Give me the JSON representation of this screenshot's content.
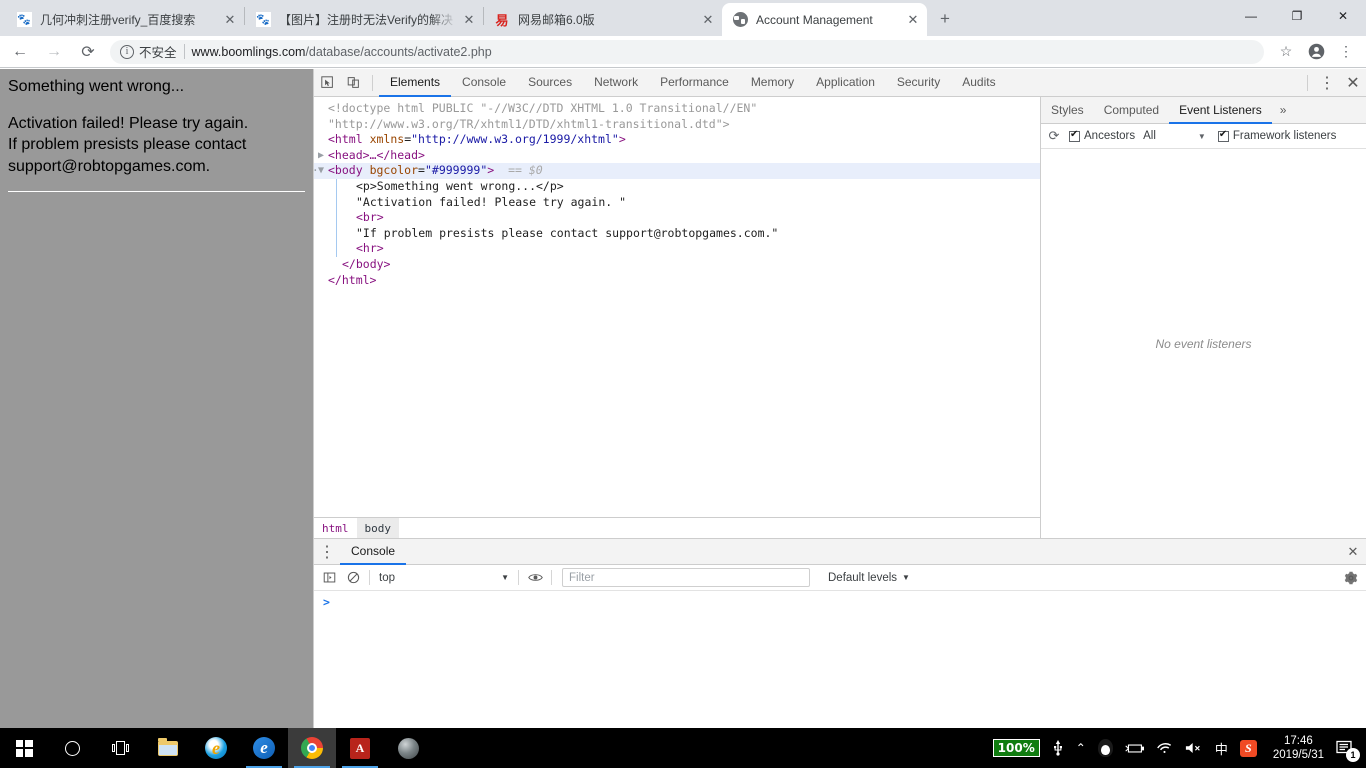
{
  "browser": {
    "tabs": [
      {
        "title": "几何冲刺注册verify_百度搜索",
        "favicon": "baidu-icon",
        "active": false
      },
      {
        "title": "【图片】注册时无法Verify的解决",
        "favicon": "baidu-icon",
        "active": false
      },
      {
        "title": "网易邮箱6.0版",
        "favicon": "netease-icon",
        "active": false
      },
      {
        "title": "Account Management",
        "favicon": "globe-icon",
        "active": true
      }
    ],
    "new_tab_label": "+",
    "window_controls": {
      "minimize": "—",
      "maximize": "❐",
      "close": "✕"
    },
    "toolbar": {
      "back": "←",
      "forward": "→",
      "reload": "⟳",
      "security_icon": "info-icon",
      "security_label": "不安全",
      "url_domain": "www.boomlings.com",
      "url_path": "/database/accounts/activate2.php",
      "bookmark": "☆",
      "profile": "account-icon",
      "menu": "⋮"
    }
  },
  "page": {
    "heading": "Something went wrong...",
    "line1": "Activation failed! Please try again.",
    "line2": "If problem presists please contact",
    "line3": "support@robtopgames.com.",
    "bgcolor": "#999999"
  },
  "devtools": {
    "inspect_icon": "inspect-cursor-icon",
    "device_icon": "device-toolbar-icon",
    "tabs": [
      {
        "label": "Elements",
        "active": true
      },
      {
        "label": "Console",
        "active": false
      },
      {
        "label": "Sources",
        "active": false
      },
      {
        "label": "Network",
        "active": false
      },
      {
        "label": "Performance",
        "active": false
      },
      {
        "label": "Memory",
        "active": false
      },
      {
        "label": "Application",
        "active": false
      },
      {
        "label": "Security",
        "active": false
      },
      {
        "label": "Audits",
        "active": false
      }
    ],
    "more_menu": "⋮",
    "close": "✕",
    "dom": {
      "line_doctype_1": "<!doctype html PUBLIC \"-//W3C//DTD XHTML 1.0 Transitional//EN\"",
      "line_doctype_2": "\"http://www.w3.org/TR/xhtml1/DTD/xhtml1-transitional.dtd\">",
      "html_tag_open": "<html",
      "html_attr_name": "xmlns",
      "html_attr_value": "\"http://www.w3.org/1999/xhtml\"",
      "html_tag_close": ">",
      "head_collapsed": "<head>…</head>",
      "body_tag_open": "<body",
      "body_attr_name": "bgcolor",
      "body_attr_value": "\"#999999\"",
      "body_tag_close": ">",
      "body_selected_marker": "== $0",
      "p_line": "<p>Something went wrong...</p>",
      "text_1": "\"Activation failed! Please try again. \"",
      "br_line": "<br>",
      "text_2": "\"If problem presists please contact support@robtopgames.com.\"",
      "hr_line": "<hr>",
      "body_end": "</body>",
      "html_end": "</html>"
    },
    "breadcrumb": [
      {
        "label": "html",
        "current": false
      },
      {
        "label": "body",
        "current": true
      }
    ],
    "sidebar": {
      "tabs": [
        {
          "label": "Styles",
          "active": false
        },
        {
          "label": "Computed",
          "active": false
        },
        {
          "label": "Event Listeners",
          "active": true
        }
      ],
      "more": "»",
      "refresh_icon": "refresh-icon",
      "ancestors_label": "Ancestors",
      "ancestors_checked": true,
      "filter_value": "All",
      "filter_caret": "▼",
      "framework_label": "Framework listeners",
      "framework_checked": true,
      "empty_message": "No event listeners"
    },
    "drawer": {
      "menu_icon": "⋮",
      "tab_label": "Console",
      "close": "✕",
      "toolbar": {
        "sidebar_icon": "console-sidebar-icon",
        "clear_icon": "clear-console-icon",
        "context_value": "top",
        "context_caret": "▼",
        "eye_icon": "live-expression-icon",
        "filter_placeholder": "Filter",
        "levels_label": "Default levels",
        "levels_caret": "▼",
        "settings_icon": "gear-icon"
      },
      "prompt": ">"
    }
  },
  "taskbar": {
    "items": [
      {
        "name": "start-button",
        "icon": "windows-logo-icon"
      },
      {
        "name": "search-button",
        "icon": "search-circle-icon"
      },
      {
        "name": "task-view-button",
        "icon": "task-view-icon"
      },
      {
        "name": "file-explorer-button",
        "icon": "folder-icon"
      },
      {
        "name": "internet-explorer-button",
        "icon": "internet-explorer-icon"
      },
      {
        "name": "edge-button",
        "icon": "edge-icon"
      },
      {
        "name": "chrome-button",
        "icon": "chrome-icon"
      },
      {
        "name": "acrobat-button",
        "icon": "acrobat-icon"
      },
      {
        "name": "photo-app-button",
        "icon": "photo-icon"
      }
    ],
    "tray": {
      "battery_percent": "100%",
      "usb_icon": "usb-icon",
      "chevron": "⌃",
      "qq_icon": "qq-penguin-icon",
      "power_icon": "battery-icon",
      "wifi_icon": "wifi-icon",
      "volume_icon": "volume-muted-icon",
      "ime_label": "中",
      "sogou_label": "S",
      "time": "17:46",
      "date": "2019/5/31",
      "notification_count": "1"
    }
  }
}
